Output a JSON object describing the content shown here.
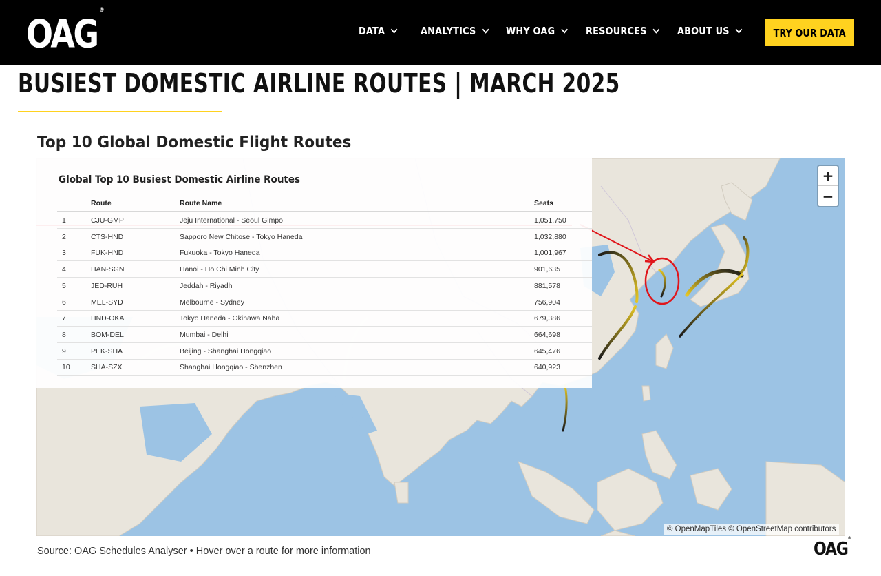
{
  "header": {
    "logo": "OAG",
    "logo_mark": "®",
    "nav": [
      {
        "label": "DATA"
      },
      {
        "label": "ANALYTICS"
      },
      {
        "label": "WHY OAG"
      },
      {
        "label": "RESOURCES"
      },
      {
        "label": "ABOUT US"
      }
    ],
    "cta": "TRY OUR DATA"
  },
  "page": {
    "title": "BUSIEST DOMESTIC AIRLINE ROUTES | MARCH 2025",
    "section_title": "Top 10 Global Domestic Flight Routes"
  },
  "table": {
    "title": "Global Top 10 Busiest Domestic Airline Routes",
    "headers": {
      "rank": "",
      "route": "Route",
      "name": "Route Name",
      "seats": "Seats"
    },
    "rows": [
      {
        "rank": "1",
        "route": "CJU-GMP",
        "name": "Jeju International - Seoul Gimpo",
        "seats": "1,051,750"
      },
      {
        "rank": "2",
        "route": "CTS-HND",
        "name": "Sapporo New Chitose - Tokyo Haneda",
        "seats": "1,032,880"
      },
      {
        "rank": "3",
        "route": "FUK-HND",
        "name": "Fukuoka - Tokyo Haneda",
        "seats": "1,001,967"
      },
      {
        "rank": "4",
        "route": "HAN-SGN",
        "name": "Hanoi - Ho Chi Minh City",
        "seats": "901,635"
      },
      {
        "rank": "5",
        "route": "JED-RUH",
        "name": "Jeddah - Riyadh",
        "seats": "881,578"
      },
      {
        "rank": "6",
        "route": "MEL-SYD",
        "name": "Melbourne - Sydney",
        "seats": "756,904"
      },
      {
        "rank": "7",
        "route": "HND-OKA",
        "name": "Tokyo Haneda - Okinawa Naha",
        "seats": "679,386"
      },
      {
        "rank": "8",
        "route": "BOM-DEL",
        "name": "Mumbai - Delhi",
        "seats": "664,698"
      },
      {
        "rank": "9",
        "route": "PEK-SHA",
        "name": "Beijing - Shanghai Hongqiao",
        "seats": "645,476"
      },
      {
        "rank": "10",
        "route": "SHA-SZX",
        "name": "Shanghai Hongqiao - Shenzhen",
        "seats": "640,923"
      }
    ]
  },
  "map": {
    "zoom_in": "+",
    "zoom_out": "−",
    "attribution": "© OpenMapTiles © OpenStreetMap contributors",
    "annotation_color": "#e0161b",
    "route_colors": [
      "#1a1a1a",
      "#e6c623"
    ]
  },
  "footer": {
    "source_prefix": "Source: ",
    "source_link": "OAG Schedules Analyser",
    "source_suffix": " • Hover over a route for more information",
    "logo": "OAG",
    "logo_mark": "®"
  },
  "colors": {
    "brand_yellow": "#ffd21f",
    "header_bg": "#000000",
    "water": "#9cc3e4",
    "land": "#e9e5dc"
  }
}
